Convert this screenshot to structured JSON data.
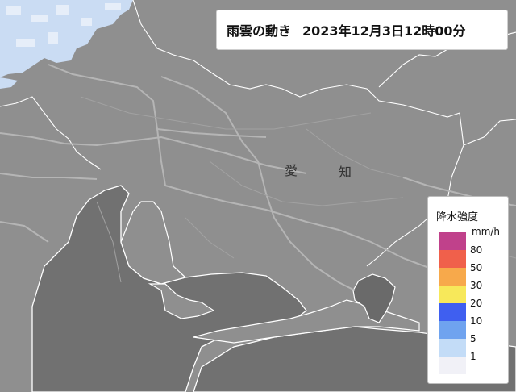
{
  "title": {
    "label": "雨雲の動き",
    "datetime": "2023年12月3日12時00分"
  },
  "legend": {
    "title": "降水強度",
    "unit": "mm/h",
    "levels": [
      {
        "label": "80",
        "color": "#c0418b"
      },
      {
        "label": "50",
        "color": "#f0604b"
      },
      {
        "label": "30",
        "color": "#f7a94b"
      },
      {
        "label": "20",
        "color": "#f7e85a"
      },
      {
        "label": "10",
        "color": "#3f5ff0"
      },
      {
        "label": "5",
        "color": "#6fa3ef"
      },
      {
        "label": "1",
        "color": "#c3dcf7"
      },
      {
        "label": "",
        "color": "#f1f1f7"
      }
    ]
  },
  "places": {
    "ai": "愛",
    "chi": "知"
  },
  "colors": {
    "land": "#8f8f8f",
    "sea": "#707070",
    "rain_light": "#c8dcf4",
    "road": "#a8a8a8"
  }
}
